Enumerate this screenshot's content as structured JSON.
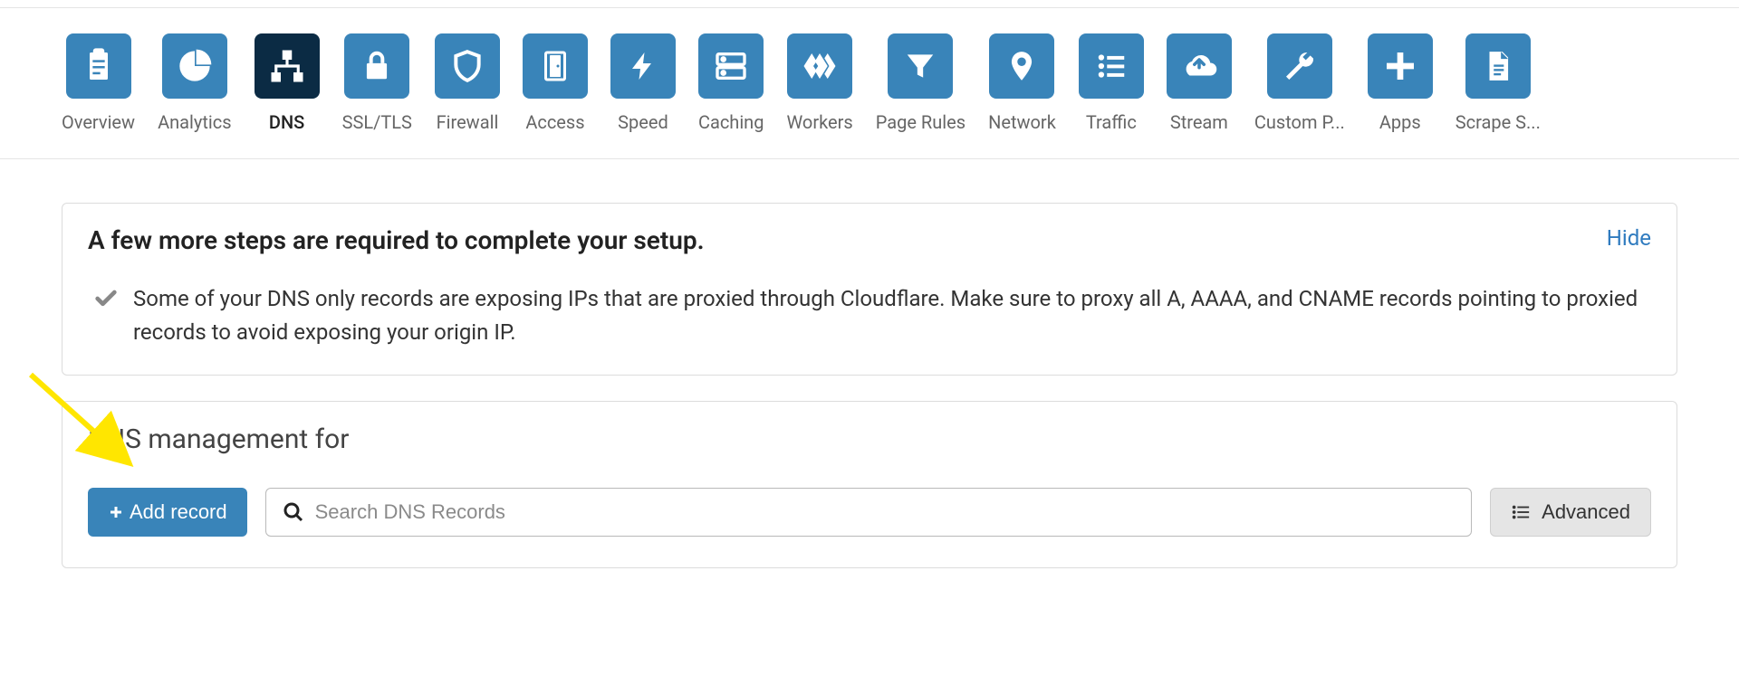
{
  "nav": {
    "items": [
      {
        "label": "Overview",
        "icon": "clipboard"
      },
      {
        "label": "Analytics",
        "icon": "pie"
      },
      {
        "label": "DNS",
        "icon": "tree",
        "active": true
      },
      {
        "label": "SSL/TLS",
        "icon": "lock"
      },
      {
        "label": "Firewall",
        "icon": "shield"
      },
      {
        "label": "Access",
        "icon": "door"
      },
      {
        "label": "Speed",
        "icon": "bolt"
      },
      {
        "label": "Caching",
        "icon": "drive"
      },
      {
        "label": "Workers",
        "icon": "workers"
      },
      {
        "label": "Page Rules",
        "icon": "filter"
      },
      {
        "label": "Network",
        "icon": "pin"
      },
      {
        "label": "Traffic",
        "icon": "list"
      },
      {
        "label": "Stream",
        "icon": "cloud"
      },
      {
        "label": "Custom P...",
        "icon": "wrench"
      },
      {
        "label": "Apps",
        "icon": "plus"
      },
      {
        "label": "Scrape S...",
        "icon": "doc"
      }
    ]
  },
  "notice": {
    "title": "A few more steps are required to complete your setup.",
    "hide": "Hide",
    "body": "Some of your DNS only records are exposing IPs that are proxied through Cloudflare. Make sure to proxy all A, AAAA, and CNAME records pointing to proxied records to avoid exposing your origin IP."
  },
  "dns": {
    "title": "DNS management for",
    "add_label": "Add record",
    "search_placeholder": "Search DNS Records",
    "advanced_label": "Advanced"
  }
}
